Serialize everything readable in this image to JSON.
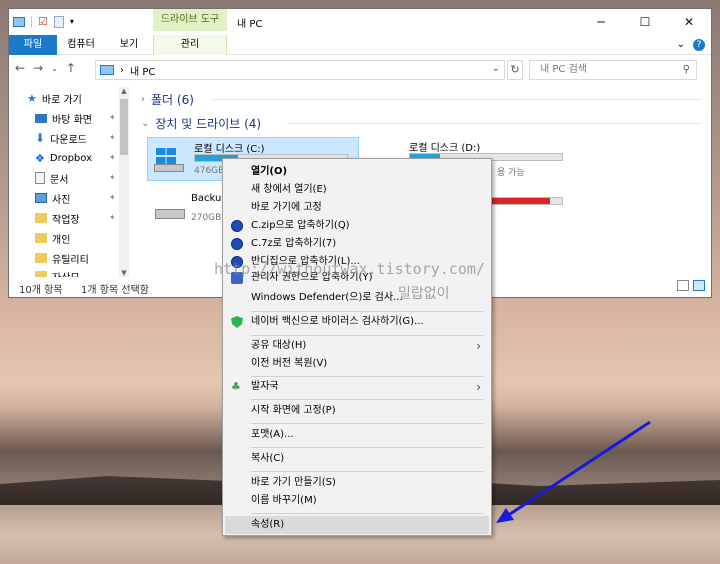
{
  "titlebar": {
    "context_tab_header": "드라이브 도구",
    "title": "내 PC",
    "minimize": "─",
    "maximize": "☐",
    "close": "✕"
  },
  "ribbon": {
    "tabs": [
      "파일",
      "컴퓨터",
      "보기",
      "관리"
    ],
    "expand": "⌄"
  },
  "address": {
    "path": "내 PC",
    "search_placeholder": "내 PC 검색"
  },
  "sidebar": {
    "items": [
      {
        "label": "바로 가기",
        "icon": "star-icon",
        "pinned": false
      },
      {
        "label": "바탕 화면",
        "icon": "desktop-icon",
        "pinned": true
      },
      {
        "label": "다운로드",
        "icon": "download-icon",
        "pinned": true
      },
      {
        "label": "Dropbox",
        "icon": "dropbox-icon",
        "pinned": true
      },
      {
        "label": "문서",
        "icon": "document-icon",
        "pinned": true
      },
      {
        "label": "사진",
        "icon": "picture-icon",
        "pinned": true
      },
      {
        "label": "작업장",
        "icon": "folder-icon",
        "pinned": true
      },
      {
        "label": "개인",
        "icon": "folder-icon",
        "pinned": false
      },
      {
        "label": "유틸리티",
        "icon": "folder-icon",
        "pinned": false
      },
      {
        "label": "자산모",
        "icon": "folder-icon",
        "pinned": false
      }
    ]
  },
  "content": {
    "folders_group": "폴더 (6)",
    "devices_group": "장치 및 드라이브 (4)",
    "drives": [
      {
        "name": "로컬 디스크 (C:)",
        "free": "476GB",
        "fill": 0.28,
        "color": "#26a0da"
      },
      {
        "name": "로컬 디스크 (D:)",
        "free": "용 가능",
        "fill": 0.2,
        "color": "#26a0da"
      },
      {
        "name": "Backup",
        "free": "270GB",
        "fill": 0.9,
        "color": "#26a0da"
      },
      {
        "name": "",
        "free": "용 가능",
        "fill": 0.92,
        "color": "#da2626"
      }
    ]
  },
  "status": {
    "count": "10개 항목",
    "selected": "1개 항목 선택함"
  },
  "menu": {
    "items": [
      {
        "label": "열기(O)",
        "bold": true
      },
      {
        "label": "새 창에서 열기(E)"
      },
      {
        "label": "바로 가기에 고정"
      },
      {
        "label": "C.zip으로 압축하기(Q)",
        "icon": "bandizip-icon"
      },
      {
        "label": "C.7z로 압축하기(7)",
        "icon": "bandizip-icon"
      },
      {
        "label": "반디집으로 압축하기(L)...",
        "icon": "bandizip-icon"
      },
      {
        "label": "관리자 권한으로 압축하기(Y)",
        "icon": "uac-shield-icon"
      },
      {
        "label": "Windows Defender(으)로 검사..."
      },
      {
        "label": "네이버 백신으로 바이러스 검사하기(G)...",
        "icon": "naver-vaccine-icon"
      },
      {
        "label": "공유 대상(H)",
        "submenu": true
      },
      {
        "label": "이전 버전 복원(V)"
      },
      {
        "label": "발자국",
        "icon": "footprint-icon",
        "submenu": true
      },
      {
        "label": "시작 화면에 고정(P)"
      },
      {
        "label": "포맷(A)..."
      },
      {
        "label": "복사(C)"
      },
      {
        "label": "바로 가기 만들기(S)"
      },
      {
        "label": "이름 바꾸기(M)"
      },
      {
        "label": "속성(R)"
      }
    ]
  },
  "watermark": {
    "url": "http://withoutwax.tistory.com/",
    "name": "밀랍없이"
  },
  "colors": {
    "accent": "#1979ca",
    "arrow": "#1a1ad8",
    "selection": "#cce8ff"
  }
}
